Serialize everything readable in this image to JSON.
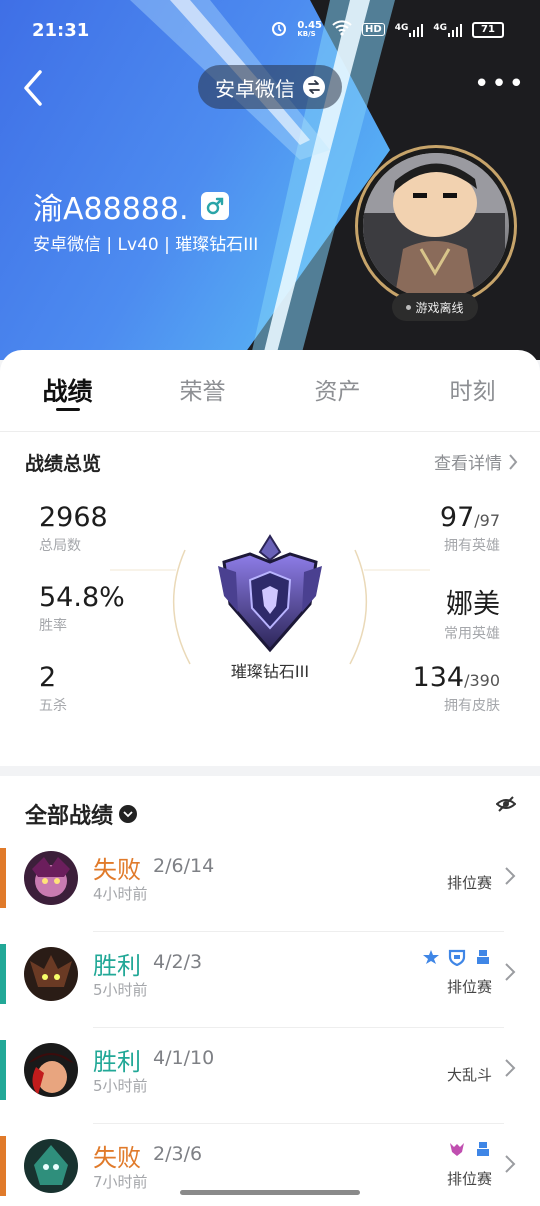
{
  "status_bar": {
    "time": "21:31",
    "net_speed_top": "0.45",
    "net_speed_unit": "KB/S",
    "hd_label": "HD",
    "sig1": "4G",
    "sig2": "4G",
    "battery": "71"
  },
  "header": {
    "account_switch_label": "安卓微信",
    "player_name": "渝A88888.",
    "player_sub": "安卓微信 | Lv40 | 璀璨钻石III",
    "status_badge": "游戏离线",
    "more_label": "•••"
  },
  "tabs": [
    {
      "label": "战绩",
      "active": true
    },
    {
      "label": "荣誉",
      "active": false
    },
    {
      "label": "资产",
      "active": false
    },
    {
      "label": "时刻",
      "active": false
    }
  ],
  "overview": {
    "title": "战绩总览",
    "detail_link": "查看详情",
    "total_games": {
      "value": "2968",
      "label": "总局数"
    },
    "win_rate": {
      "value": "54.8%",
      "label": "胜率"
    },
    "penta_kills": {
      "value": "2",
      "label": "五杀"
    },
    "heroes_owned": {
      "value": "97",
      "total": "/97",
      "label": "拥有英雄"
    },
    "common_hero": {
      "value": "娜美",
      "label": "常用英雄"
    },
    "skins_owned": {
      "value": "134",
      "total": "/390",
      "label": "拥有皮肤"
    },
    "rank_name": "璀璨钻石III"
  },
  "matches": {
    "title": "全部战绩",
    "items": [
      {
        "result": "失败",
        "outcome": "lose",
        "kda": "2/6/14",
        "time": "4小时前",
        "mode": "排位赛",
        "badges": []
      },
      {
        "result": "胜利",
        "outcome": "win",
        "kda": "4/2/3",
        "time": "5小时前",
        "mode": "排位赛",
        "badges": [
          "mvp-icon",
          "shield-icon",
          "tower-icon"
        ]
      },
      {
        "result": "胜利",
        "outcome": "win",
        "kda": "4/1/10",
        "time": "5小时前",
        "mode": "大乱斗",
        "badges": []
      },
      {
        "result": "失败",
        "outcome": "lose",
        "kda": "2/3/6",
        "time": "7小时前",
        "mode": "排位赛",
        "badges": [
          "demon-icon",
          "tower-icon"
        ]
      }
    ]
  },
  "colors": {
    "win": "#22a897",
    "lose": "#e07a2a",
    "header_blue": "#4d8cf0"
  }
}
